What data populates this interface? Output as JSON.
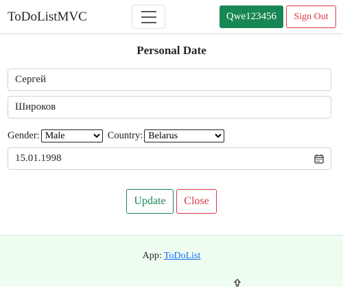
{
  "navbar": {
    "brand": "ToDoListMVC",
    "user_button": "Qwe123456",
    "signout_button": "Sign Out",
    "menu_icon": "hamburger-menu-icon"
  },
  "form": {
    "heading": "Personal Date",
    "first_name": "Сергей",
    "last_name": "Широков",
    "gender_label": "Gender:",
    "gender_value": "Male",
    "country_label": "Country:",
    "country_value": "Belarus",
    "birth_date": "15.01.1998",
    "date_icon": "calendar-icon",
    "update_button": "Update",
    "close_button": "Close"
  },
  "footer": {
    "app_label": "App:",
    "app_link": "ToDoList"
  },
  "colors": {
    "success": "#198754",
    "danger": "#dc3545",
    "link": "#0d6efd",
    "footer_bg": "#effcf0"
  }
}
